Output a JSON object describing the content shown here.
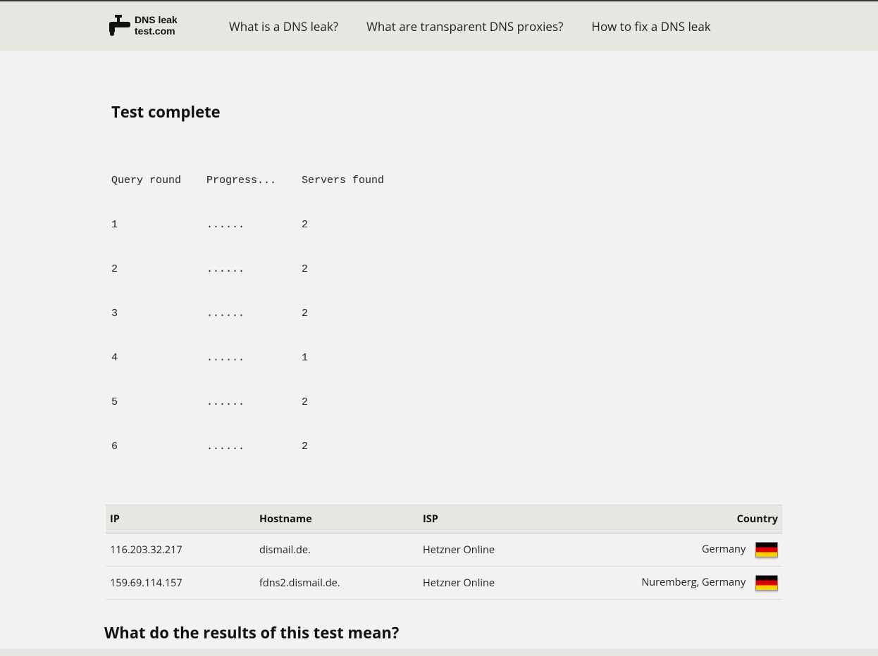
{
  "site": {
    "name_line1": "DNS leak",
    "name_line2": "test.com"
  },
  "nav": {
    "items": [
      {
        "label": "What is a DNS leak?"
      },
      {
        "label": "What are transparent DNS proxies?"
      },
      {
        "label": "How to fix a DNS leak"
      }
    ]
  },
  "heading": "Test complete",
  "progress": {
    "headers": {
      "round": "Query round",
      "progress": "Progress...",
      "found": "Servers found"
    },
    "rows": [
      {
        "round": "1",
        "progress": "......",
        "found": "2"
      },
      {
        "round": "2",
        "progress": "......",
        "found": "2"
      },
      {
        "round": "3",
        "progress": "......",
        "found": "2"
      },
      {
        "round": "4",
        "progress": "......",
        "found": "1"
      },
      {
        "round": "5",
        "progress": "......",
        "found": "2"
      },
      {
        "round": "6",
        "progress": "......",
        "found": "2"
      }
    ]
  },
  "table": {
    "headers": {
      "ip": "IP",
      "hostname": "Hostname",
      "isp": "ISP",
      "country": "Country"
    },
    "rows": [
      {
        "ip": "116.203.32.217",
        "hostname": "dismail.de.",
        "isp": "Hetzner Online",
        "country": "Germany",
        "flag": "de"
      },
      {
        "ip": "159.69.114.157",
        "hostname": "fdns2.dismail.de.",
        "isp": "Hetzner Online",
        "country": "Nuremberg, Germany",
        "flag": "de"
      }
    ]
  },
  "subheading": "What do the results of this test mean?"
}
